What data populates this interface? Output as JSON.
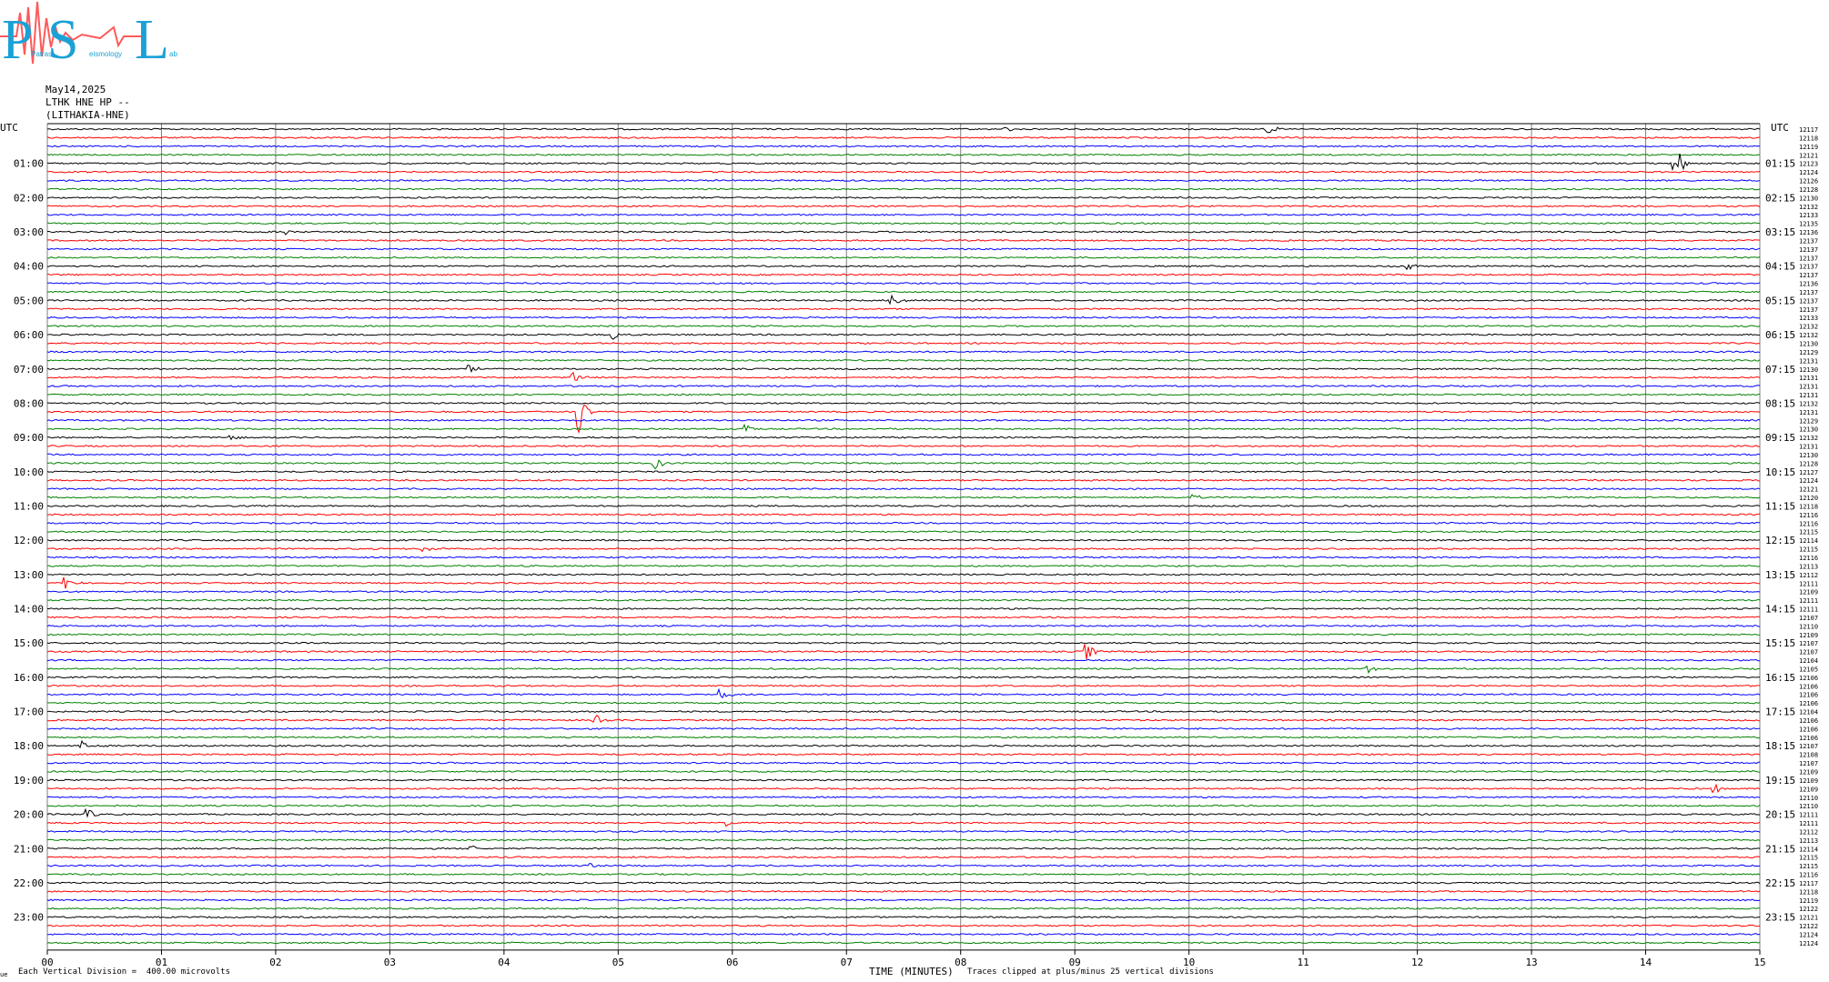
{
  "logo": {
    "letters": [
      "P",
      "S",
      "L"
    ],
    "words": [
      "Patras",
      "eismology",
      "ab"
    ]
  },
  "header": {
    "date": "May14,2025",
    "station_line": "LTHK HNE HP --",
    "station_name": "(LITHAKIA-HNE)"
  },
  "axis_labels": {
    "left_unit": "UTC",
    "right_unit": "UTC"
  },
  "footer": {
    "scale_text": "Each Vertical Division =  400.00 microvolts",
    "xlabel": "TIME (MINUTES)",
    "clip_note": "Traces clipped at plus/minus 25 vertical divisions",
    "corner_mark": "ue"
  },
  "colors": {
    "trace_cycle": [
      "#000000",
      "#ff0000",
      "#0000ff",
      "#008000"
    ],
    "grid": "#808080",
    "logo_primary": "#1ba1d6",
    "logo_secondary": "#ff5a5a"
  },
  "chart_data": {
    "type": "line",
    "xlabel": "TIME (MINUTES)",
    "ylabel": "UTC",
    "xlim": [
      0,
      15
    ],
    "x_ticks": [
      "00",
      "01",
      "02",
      "03",
      "04",
      "05",
      "06",
      "07",
      "08",
      "09",
      "10",
      "11",
      "12",
      "13",
      "14",
      "15"
    ],
    "trace_interval_minutes": 15,
    "trace_count": 96,
    "left_hour_labels": [
      "01:00",
      "02:00",
      "03:00",
      "04:00",
      "05:00",
      "06:00",
      "07:00",
      "08:00",
      "09:00",
      "10:00",
      "11:00",
      "12:00",
      "13:00",
      "14:00",
      "15:00",
      "16:00",
      "17:00",
      "18:00",
      "19:00",
      "20:00",
      "21:00",
      "22:00",
      "23:00"
    ],
    "right_hour_labels": [
      "01:15",
      "02:15",
      "03:15",
      "04:15",
      "05:15",
      "06:15",
      "07:15",
      "08:15",
      "09:15",
      "10:15",
      "11:15",
      "12:15",
      "13:15",
      "14:15",
      "15:15",
      "16:15",
      "17:15",
      "18:15",
      "19:15",
      "20:15",
      "21:15",
      "22:15",
      "23:15"
    ],
    "right_counts": [
      "12117",
      "12118",
      "12119",
      "12121",
      "12123",
      "12124",
      "12126",
      "12128",
      "12130",
      "12132",
      "12133",
      "12135",
      "12136",
      "12137",
      "12137",
      "12137",
      "12137",
      "12137",
      "12136",
      "12137",
      "12137",
      "12137",
      "12133",
      "12132",
      "12132",
      "12130",
      "12129",
      "12131",
      "12130",
      "12131",
      "12131",
      "12131",
      "12132",
      "12131",
      "12129",
      "12130",
      "12132",
      "12131",
      "12130",
      "12128",
      "12127",
      "12124",
      "12121",
      "12120",
      "12118",
      "12116",
      "12116",
      "12115",
      "12114",
      "12115",
      "12116",
      "12113",
      "12112",
      "12111",
      "12109",
      "12111",
      "12111",
      "12107",
      "12110",
      "12109",
      "12107",
      "12107",
      "12104",
      "12105",
      "12106",
      "12106",
      "12106",
      "12106",
      "12104",
      "12106",
      "12106",
      "12106",
      "12107",
      "12108",
      "12107",
      "12109",
      "12109",
      "12109",
      "12110",
      "12110",
      "12111",
      "12111",
      "12112",
      "12113",
      "12114",
      "12115",
      "12115",
      "12116",
      "12117",
      "12118",
      "12119",
      "12122",
      "12121",
      "12122",
      "12124",
      "12124"
    ],
    "events": [
      {
        "trace": 0,
        "minute": 8.4,
        "amp": 0.4
      },
      {
        "trace": 0,
        "minute": 10.7,
        "amp": 0.5
      },
      {
        "trace": 4,
        "minute": 14.25,
        "amp": 3.2
      },
      {
        "trace": 12,
        "minute": 2.1,
        "amp": 0.4
      },
      {
        "trace": 16,
        "minute": 11.9,
        "amp": 0.6
      },
      {
        "trace": 20,
        "minute": 7.4,
        "amp": 0.8
      },
      {
        "trace": 24,
        "minute": 4.95,
        "amp": 0.7
      },
      {
        "trace": 28,
        "minute": 3.7,
        "amp": 0.5
      },
      {
        "trace": 29,
        "minute": 4.6,
        "amp": 0.8
      },
      {
        "trace": 33,
        "minute": 4.65,
        "amp": 3.0
      },
      {
        "trace": 35,
        "minute": 6.1,
        "amp": 0.8
      },
      {
        "trace": 36,
        "minute": 1.6,
        "amp": 0.6
      },
      {
        "trace": 39,
        "minute": 5.3,
        "amp": 1.3
      },
      {
        "trace": 43,
        "minute": 10.0,
        "amp": 1.0
      },
      {
        "trace": 49,
        "minute": 3.3,
        "amp": 0.5
      },
      {
        "trace": 53,
        "minute": 0.15,
        "amp": 1.2
      },
      {
        "trace": 61,
        "minute": 9.1,
        "amp": 1.1
      },
      {
        "trace": 63,
        "minute": 11.55,
        "amp": 0.7
      },
      {
        "trace": 66,
        "minute": 5.9,
        "amp": 0.8
      },
      {
        "trace": 69,
        "minute": 4.8,
        "amp": 0.9
      },
      {
        "trace": 72,
        "minute": 0.3,
        "amp": 0.7
      },
      {
        "trace": 77,
        "minute": 14.6,
        "amp": 0.6
      },
      {
        "trace": 80,
        "minute": 0.35,
        "amp": 0.6
      },
      {
        "trace": 81,
        "minute": 5.95,
        "amp": 0.5
      },
      {
        "trace": 84,
        "minute": 3.7,
        "amp": 0.5
      },
      {
        "trace": 86,
        "minute": 4.75,
        "amp": 0.5
      }
    ]
  }
}
